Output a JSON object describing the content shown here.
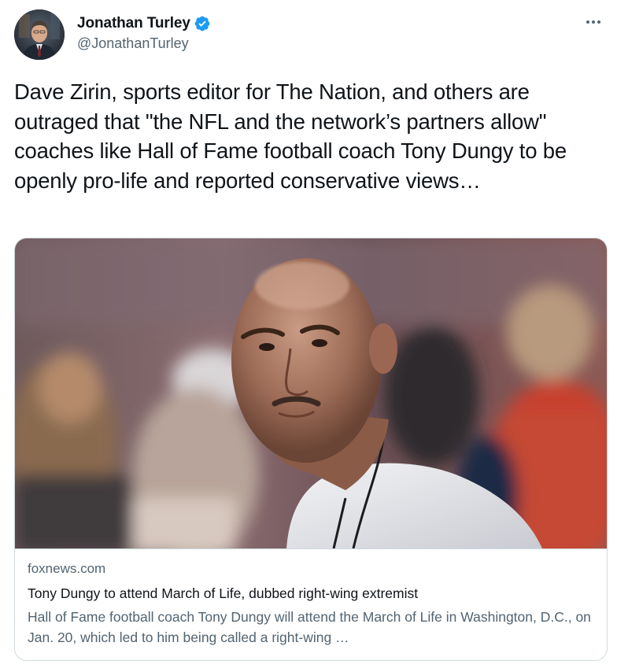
{
  "tweet": {
    "author": {
      "display_name": "Jonathan Turley",
      "handle": "@JonathanTurley",
      "verified": true,
      "avatar_icon": "profile-avatar"
    },
    "more_icon": "more-horizontal-icon",
    "text": "Dave Zirin, sports editor for The Nation, and others are outraged that \"the NFL and the network’s partners allow\" coaches like Hall of Fame football coach Tony Dungy to be openly pro-life and reported conservative views…"
  },
  "card": {
    "image_icon": "article-photo",
    "domain": "foxnews.com",
    "title": "Tony Dungy to attend March of Life, dubbed right-wing extremist",
    "description": "Hall of Fame football coach Tony Dungy will attend the March of Life in Washington, D.C., on Jan. 20, which led to him being called a right-wing …"
  },
  "colors": {
    "text_primary": "#0f1419",
    "text_secondary": "#536471",
    "verified_blue": "#1d9bf0",
    "card_border": "#cfd9de"
  }
}
